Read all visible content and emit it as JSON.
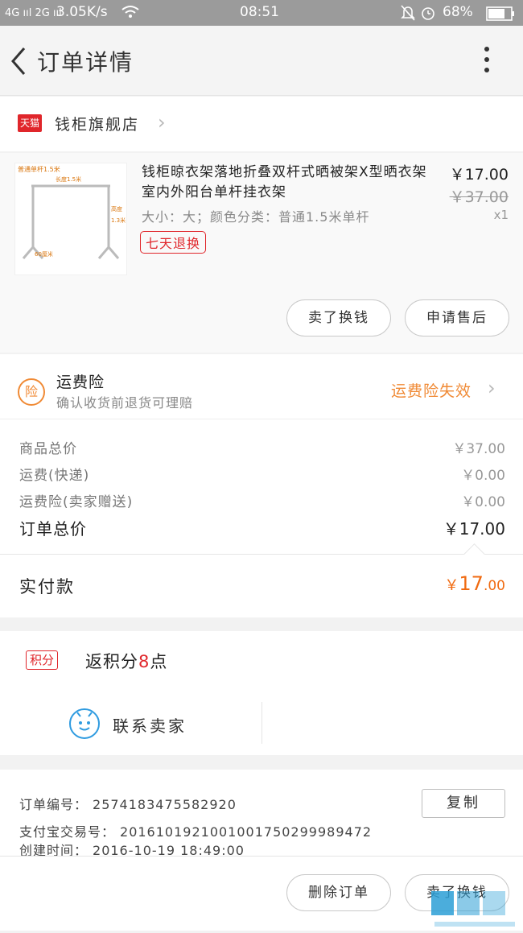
{
  "status_bar": {
    "network": "4G ııl 2G ııl",
    "speed": "3.05K/s",
    "time": "08:51",
    "battery": "68%"
  },
  "header": {
    "title": "订单详情"
  },
  "store": {
    "badge": "天猫",
    "name": "钱柜旗舰店"
  },
  "product": {
    "title": "钱柜晾衣架落地折叠双杆式晒被架X型晒衣架室内外阳台单杆挂衣架",
    "spec": "大小：大；颜色分类：普通1.5米单杆",
    "price": "￥17.00",
    "original_price": "￥37.00",
    "quantity": "x1",
    "tag": "七天退换",
    "image_labels": {
      "top": "普通单杆1.5米",
      "inner": "长度1.5米",
      "height": "高度",
      "height_val": "1.3米",
      "bottom": "60厘米"
    }
  },
  "product_actions": {
    "sell": "卖了换钱",
    "after_sale": "申请售后"
  },
  "insurance": {
    "icon": "险",
    "title": "运费险",
    "subtitle": "确认收货前退货可理赔",
    "status": "运费险失效"
  },
  "cost": {
    "rows": [
      {
        "label": "商品总价",
        "value": "￥37.00"
      },
      {
        "label": "运费(快递)",
        "value": "￥0.00"
      },
      {
        "label": "运费险(卖家赠送)",
        "value": "￥0.00"
      }
    ],
    "total_label": "订单总价",
    "total_value": "￥17.00"
  },
  "paid": {
    "label": "实付款",
    "currency": "￥",
    "integer": "17",
    "decimal": ".00"
  },
  "points": {
    "badge": "积分",
    "prefix": "返积分",
    "count": "8",
    "suffix": "点"
  },
  "contact": {
    "label": "联系卖家"
  },
  "order_info": {
    "number_label": "订单编号：",
    "number": "2574183475582920",
    "alipay_label": "支付宝交易号：",
    "alipay": "2016101921001001750299989472",
    "created_label": "创建时间：",
    "created": "2016-10-19 18:49:00",
    "copy": "复制"
  },
  "footer": {
    "delete": "删除订单",
    "sell": "卖了换钱"
  },
  "colors": {
    "accent": "#f06a10",
    "brand": "#e0262b",
    "insurance": "#f08a35",
    "contact": "#2f9be0"
  }
}
